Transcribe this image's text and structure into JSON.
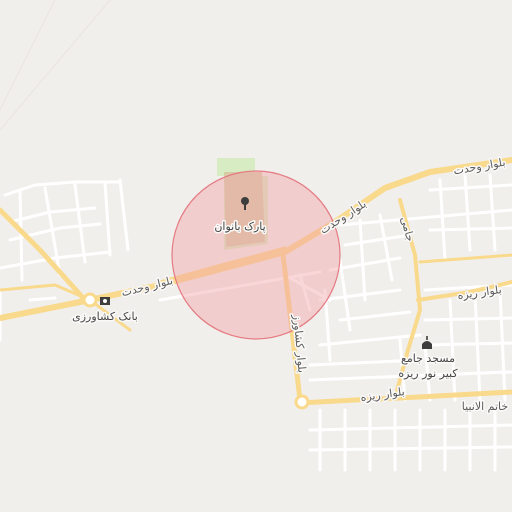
{
  "map": {
    "labels": {
      "park": "پارک بانوان",
      "bank": "بانک کشاورزی",
      "mosque_line1": "مسجد جامع",
      "mosque_line2": "کبیر نور ریزه",
      "road_vahdat_left": "بلوار وحدت",
      "road_vahdat_mid": "بلوار وحدت",
      "road_vahdat_right": "بلوار وحدت",
      "road_keshavarz": "بلوار کشاورز",
      "road_rizeh_east": "بلوار ریزه",
      "road_rizeh_south": "بلوار ریزه",
      "road_jami": "جامی",
      "road_khatam": "خاتم الانبیا"
    },
    "icons": {
      "park": "tree-icon",
      "bank": "bank-icon",
      "mosque": "mosque-icon"
    },
    "colors": {
      "background": "#f1efec",
      "minor_road": "#ffffff",
      "major_road": "#f9d98b",
      "park": "#d8ecc4",
      "highlight_fill": "#f2a3a8",
      "highlight_stroke": "#e57a82"
    }
  }
}
